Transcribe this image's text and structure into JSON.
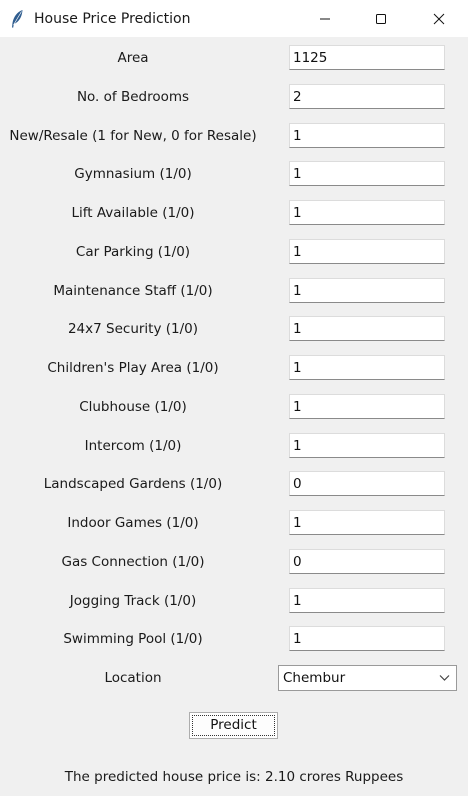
{
  "window": {
    "title": "House Price Prediction",
    "icon": "feather-icon"
  },
  "form": {
    "fields": [
      {
        "label": "Area",
        "value": "1125"
      },
      {
        "label": "No. of Bedrooms",
        "value": "2"
      },
      {
        "label": "New/Resale (1 for New, 0 for Resale)",
        "value": "1"
      },
      {
        "label": "Gymnasium (1/0)",
        "value": "1"
      },
      {
        "label": "Lift Available (1/0)",
        "value": "1"
      },
      {
        "label": "Car Parking (1/0)",
        "value": "1"
      },
      {
        "label": "Maintenance Staff (1/0)",
        "value": "1"
      },
      {
        "label": "24x7 Security (1/0)",
        "value": "1"
      },
      {
        "label": "Children's Play Area (1/0)",
        "value": "1"
      },
      {
        "label": "Clubhouse (1/0)",
        "value": "1"
      },
      {
        "label": "Intercom (1/0)",
        "value": "1"
      },
      {
        "label": "Landscaped Gardens (1/0)",
        "value": "0"
      },
      {
        "label": "Indoor Games (1/0)",
        "value": "1"
      },
      {
        "label": "Gas Connection (1/0)",
        "value": "0"
      },
      {
        "label": "Jogging Track (1/0)",
        "value": "1"
      },
      {
        "label": "Swimming Pool (1/0)",
        "value": "1"
      }
    ],
    "location": {
      "label": "Location",
      "value": "Chembur"
    },
    "predict_label": "Predict",
    "result_text": "The predicted house price is: 2.10 crores Ruppees"
  }
}
